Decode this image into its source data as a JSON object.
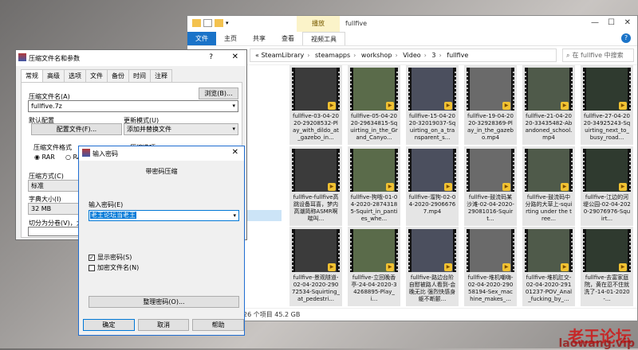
{
  "explorer": {
    "title": "fullfive",
    "context_tab": "播放",
    "tabs": [
      "文件",
      "主页",
      "共享",
      "查看",
      "视频工具"
    ],
    "address": [
      "SteamLibrary",
      "steamapps",
      "workshop",
      "Video",
      "3",
      "fullfive"
    ],
    "search_placeholder": "在 fullfive 中搜索",
    "status": "26 个项目   45.2 GB",
    "files": [
      "fullfive-03-04-2020-29208532-Play_with_dildo_at_gazebo_in...",
      "fullfive-05-04-2020-29634815-Squirting_in_the_Grand_Canyo...",
      "fullfive-15-04-2020-32019037-Squirting_on_a_transparent_s...",
      "fullfive-19-04-2020-32928369-Play_in_the_gazebo.mp4",
      "fullfive-21-04-2020-33435482-Abandoned_school.mp4",
      "fullfive-27-04-2020-34925243-Squirting_next_to_busy_road...",
      "fullfive-fullfive高跳设备耳喜，梦内高潮简称ASMR啊喘叫...",
      "fullfive-狗哦-01-04-2020-28743185-Squirt_in_panties_whe...",
      "fullfive-溜狗-02-04-2020-29066767.mp4",
      "fullfive-鼓流码某沙滩-02-04-2020-29081016-Squirt...",
      "fullfive-鼓流码中分路的大草上-squirting under the tree...",
      "fullfive-江边的河堤公园-02-04-2020-29076976-Squirt...",
      "fullfive-景观隧道-02-04-2020-29072534-Squirting_at_pedestri...",
      "fullfive-立回晚香亭-24-04-2020-34268895-Play_i...",
      "fullfive-路边台阶自慰被路人看到-会晚无比 强烈快感身躯不断颤...",
      "fullfive-堆机嘲嗨-02-04-2020-29058194-Sex_machine_makes_...",
      "fullfive-堆机肛交-02-04-2020-29101237-POV_Anal_fucking_by_...",
      "fullfive-去富家庭院，黄在忍不住就洗了-14-01-2020-..."
    ]
  },
  "rar_dialog": {
    "title": "压缩文件名和参数",
    "help": "?",
    "tabs": [
      "常规",
      "高级",
      "选项",
      "文件",
      "备份",
      "时间",
      "注释"
    ],
    "archive_name_label": "压缩文件名(A)",
    "browse_button": "浏览(B)...",
    "archive_name_value": "fullfive.7z",
    "default_config_label": "默认配置",
    "profile_button": "配置文件(F)...",
    "update_mode_label": "更新模式(U)",
    "update_mode_value": "添加并替换文件",
    "format_label": "压缩文件格式",
    "format_rar": "RAR",
    "format_rar4": "RAR",
    "options_label": "压缩选项",
    "method_label": "压缩方式(C)",
    "method_value": "标准",
    "dict_label": "字典大小(I)",
    "dict_value": "32 MB",
    "split_label": "切分为分卷(V)，大"
  },
  "password_dialog": {
    "title": "输入密码",
    "subtitle": "带密码压缩",
    "input_label": "输入密码(E)",
    "password_value": "老王论坛当老王",
    "show_password": "显示密码(S)",
    "encrypt_names": "加密文件名(N)",
    "manage_button": "整理密码(O)...",
    "ok": "确定",
    "cancel": "取消",
    "help": "帮助"
  },
  "watermark": {
    "text1": "老王论坛",
    "text2": "laowang.vip"
  },
  "colors": {
    "accent": "#1a73c8",
    "thumb_badge": "#f1c232",
    "dialog_border": "#1f6dd1"
  }
}
